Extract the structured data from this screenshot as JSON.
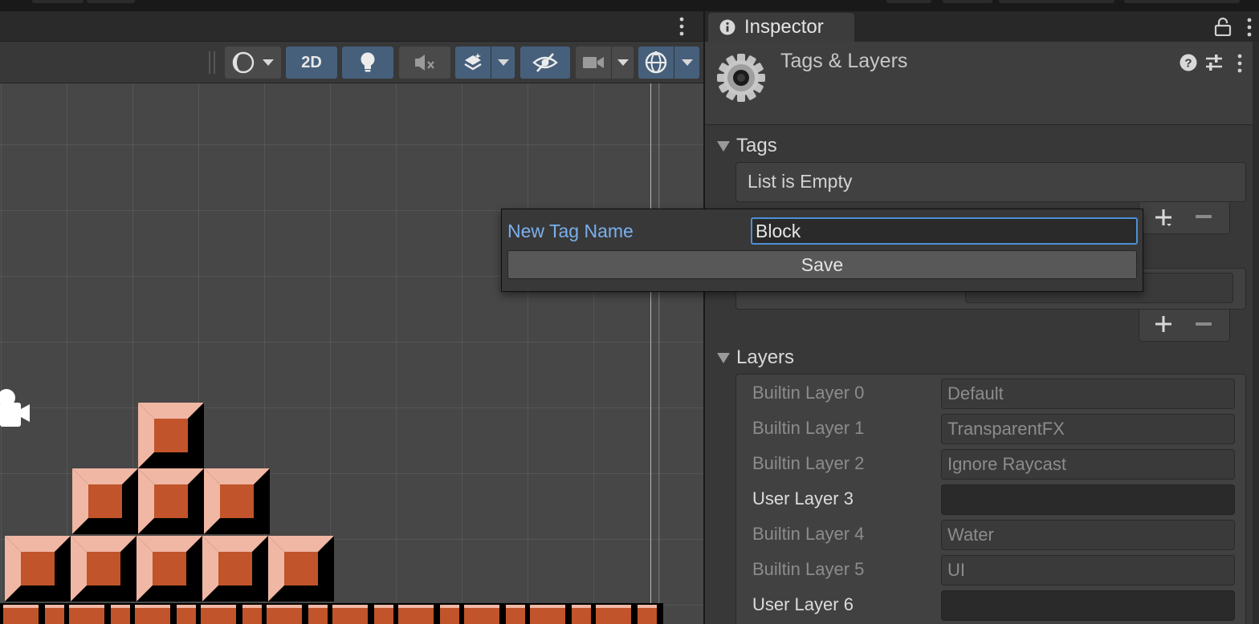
{
  "inspector": {
    "tab_label": "Inspector",
    "tab_icon": "info-icon",
    "lock_icon": "lock-icon",
    "menu_icon": "kebab-menu-icon",
    "header": {
      "title": "Tags & Layers",
      "icon": "gear-icon",
      "help_icon": "help-icon",
      "preset_icon": "preset-sliders-icon",
      "menu_icon": "kebab-menu-icon"
    },
    "tags": {
      "title": "Tags",
      "empty_text": "List is Empty"
    },
    "layers": {
      "title": "Layers",
      "rows": [
        {
          "label": "Builtin Layer 0",
          "value": "Default",
          "kind": "builtin"
        },
        {
          "label": "Builtin Layer 1",
          "value": "TransparentFX",
          "kind": "builtin"
        },
        {
          "label": "Builtin Layer 2",
          "value": "Ignore Raycast",
          "kind": "builtin"
        },
        {
          "label": "User Layer 3",
          "value": "",
          "kind": "user"
        },
        {
          "label": "Builtin Layer 4",
          "value": "Water",
          "kind": "builtin"
        },
        {
          "label": "Builtin Layer 5",
          "value": "UI",
          "kind": "builtin"
        },
        {
          "label": "User Layer 6",
          "value": "",
          "kind": "user"
        }
      ]
    }
  },
  "popup": {
    "label": "New Tag Name",
    "input_value": "Block",
    "save_label": "Save"
  },
  "scene_toolbar": {
    "mode_2d_label": "2D",
    "mode_2d_active": true,
    "lighting_active": true,
    "audio_active": false,
    "effects_active": true,
    "hidden_objects_active": true,
    "camera_active": false,
    "gizmos_active": true,
    "icons": [
      "draw-mode-icon",
      "lightbulb-icon",
      "audio-mute-icon",
      "effects-layers-icon",
      "visibility-eye-icon",
      "camera-icon",
      "gizmos-globe-icon"
    ]
  },
  "colors": {
    "accent_blue": "#46607c",
    "focus_blue": "#4d8fd6",
    "label_blue": "#7bb0ee",
    "block_main": "#c1542a",
    "block_light": "#f0b7a4",
    "block_dark": "#000000"
  }
}
